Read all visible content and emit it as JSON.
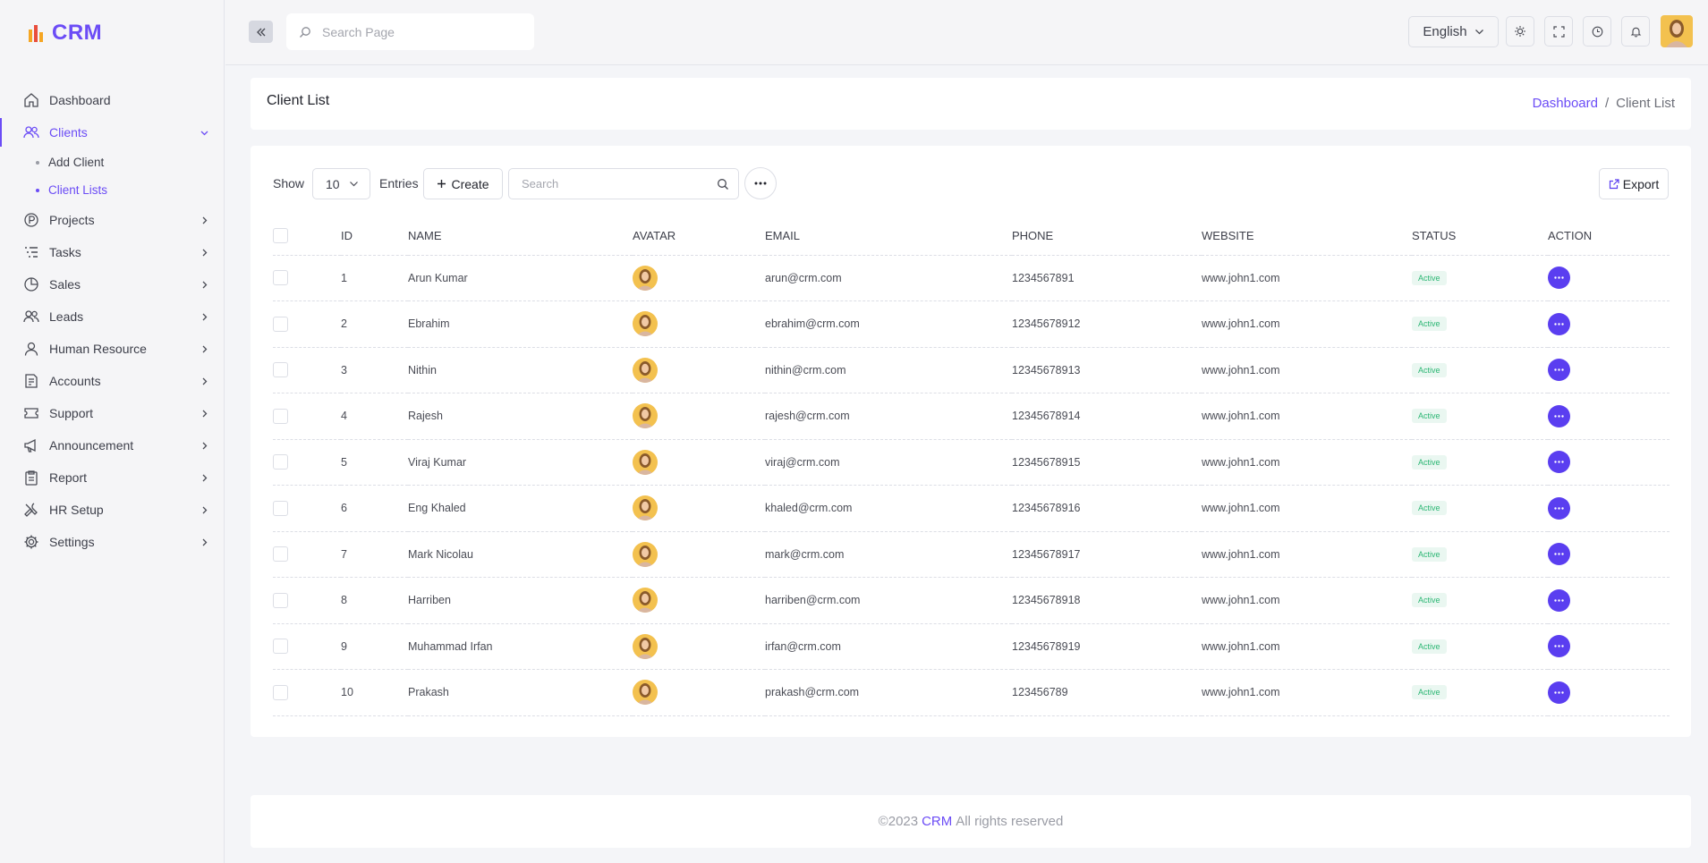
{
  "brand": {
    "name": "CRM"
  },
  "sidebar": {
    "items": [
      {
        "label": "Dashboard",
        "icon": "home-icon",
        "has_chevron": false
      },
      {
        "label": "Clients",
        "icon": "users-icon",
        "active": true,
        "expanded": true,
        "children": [
          {
            "label": "Add Client"
          },
          {
            "label": "Client Lists",
            "active": true
          }
        ]
      },
      {
        "label": "Projects",
        "icon": "projects-icon"
      },
      {
        "label": "Tasks",
        "icon": "tasks-icon"
      },
      {
        "label": "Sales",
        "icon": "sales-icon"
      },
      {
        "label": "Leads",
        "icon": "leads-icon"
      },
      {
        "label": "Human Resource",
        "icon": "user-icon"
      },
      {
        "label": "Accounts",
        "icon": "accounts-icon"
      },
      {
        "label": "Support",
        "icon": "ticket-icon"
      },
      {
        "label": "Announcement",
        "icon": "megaphone-icon"
      },
      {
        "label": "Report",
        "icon": "clipboard-icon"
      },
      {
        "label": "HR Setup",
        "icon": "tools-icon"
      },
      {
        "label": "Settings",
        "icon": "gear-icon"
      }
    ]
  },
  "topbar": {
    "search_placeholder": "Search Page",
    "language": "English"
  },
  "header": {
    "title": "Client List",
    "breadcrumb": {
      "link": "Dashboard",
      "separator": "/",
      "current": "Client List"
    }
  },
  "toolbar": {
    "show_label": "Show",
    "entries_value": "10",
    "entries_label": "Entries",
    "create_label": "Create",
    "search_placeholder": "Search",
    "export_label": "Export"
  },
  "table": {
    "columns": [
      "ID",
      "NAME",
      "AVATAR",
      "EMAIL",
      "PHONE",
      "WEBSITE",
      "STATUS",
      "ACTION"
    ],
    "rows": [
      {
        "id": "1",
        "name": "Arun Kumar",
        "email": "arun@crm.com",
        "phone": "1234567891",
        "website": "www.john1.com",
        "status": "Active"
      },
      {
        "id": "2",
        "name": "Ebrahim",
        "email": "ebrahim@crm.com",
        "phone": "12345678912",
        "website": "www.john1.com",
        "status": "Active"
      },
      {
        "id": "3",
        "name": "Nithin",
        "email": "nithin@crm.com",
        "phone": "12345678913",
        "website": "www.john1.com",
        "status": "Active"
      },
      {
        "id": "4",
        "name": "Rajesh",
        "email": "rajesh@crm.com",
        "phone": "12345678914",
        "website": "www.john1.com",
        "status": "Active"
      },
      {
        "id": "5",
        "name": "Viraj Kumar",
        "email": "viraj@crm.com",
        "phone": "12345678915",
        "website": "www.john1.com",
        "status": "Active"
      },
      {
        "id": "6",
        "name": "Eng Khaled",
        "email": "khaled@crm.com",
        "phone": "12345678916",
        "website": "www.john1.com",
        "status": "Active"
      },
      {
        "id": "7",
        "name": "Mark Nicolau",
        "email": "mark@crm.com",
        "phone": "12345678917",
        "website": "www.john1.com",
        "status": "Active"
      },
      {
        "id": "8",
        "name": "Harriben",
        "email": "harriben@crm.com",
        "phone": "12345678918",
        "website": "www.john1.com",
        "status": "Active"
      },
      {
        "id": "9",
        "name": "Muhammad Irfan",
        "email": "irfan@crm.com",
        "phone": "12345678919",
        "website": "www.john1.com",
        "status": "Active"
      },
      {
        "id": "10",
        "name": "Prakash",
        "email": "prakash@crm.com",
        "phone": "123456789",
        "website": "www.john1.com",
        "status": "Active"
      }
    ]
  },
  "footer": {
    "copyright": "©2023",
    "brand": "CRM",
    "rights": "All rights reserved"
  },
  "colors": {
    "accent": "#6b4cf6",
    "action": "#5a3ef0",
    "status_active_text": "#2bb673",
    "status_active_bg": "#eaf7f1"
  }
}
